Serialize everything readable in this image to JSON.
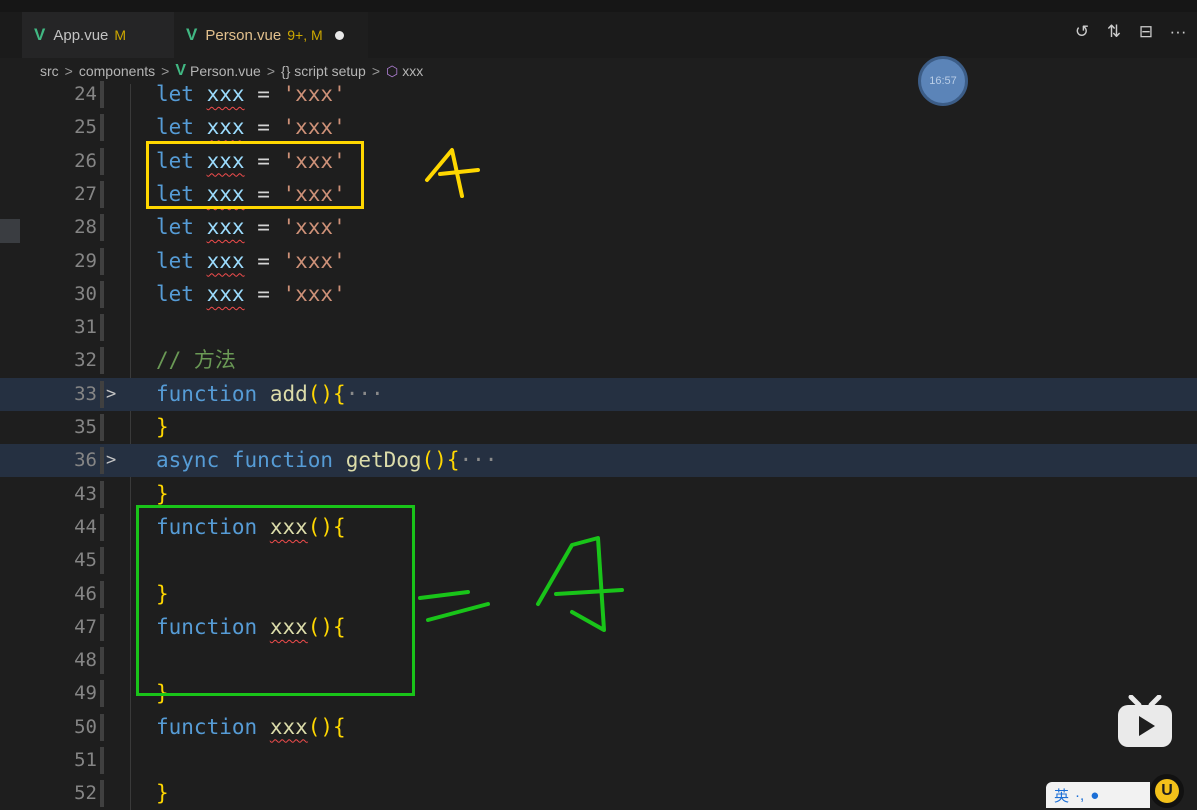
{
  "tabs": [
    {
      "name": "App.vue",
      "status": "M"
    },
    {
      "name": "Person.vue",
      "status": "9+, M"
    }
  ],
  "toolbar_icons": [
    "history-icon",
    "compare-changes-icon",
    "split-editor-icon",
    "more-actions-icon"
  ],
  "toolbar_glyphs": {
    "history": "↺",
    "compare": "⇅",
    "split": "⊟",
    "more": "···"
  },
  "breadcrumb": {
    "items": [
      "src",
      "components",
      "Person.vue",
      "{} script setup",
      "xxx"
    ],
    "separator": ">"
  },
  "code_lines": [
    {
      "num": "24",
      "text": "let xxx = 'xxx'"
    },
    {
      "num": "25",
      "text": "let xxx = 'xxx'"
    },
    {
      "num": "26",
      "text": "let xxx = 'xxx'"
    },
    {
      "num": "27",
      "text": "let xxx = 'xxx'"
    },
    {
      "num": "28",
      "text": "let xxx = 'xxx'"
    },
    {
      "num": "29",
      "text": "let xxx = 'xxx'"
    },
    {
      "num": "30",
      "text": "let xxx = 'xxx'"
    },
    {
      "num": "31",
      "text": ""
    },
    {
      "num": "32",
      "text": "// 方法"
    },
    {
      "num": "33",
      "text": "function add(){···"
    },
    {
      "num": "35",
      "text": "}"
    },
    {
      "num": "36",
      "text": "async function getDog(){···"
    },
    {
      "num": "43",
      "text": "}"
    },
    {
      "num": "44",
      "text": "function xxx(){"
    },
    {
      "num": "45",
      "text": ""
    },
    {
      "num": "46",
      "text": "}"
    },
    {
      "num": "47",
      "text": "function xxx(){"
    },
    {
      "num": "48",
      "text": ""
    },
    {
      "num": "49",
      "text": "}"
    },
    {
      "num": "50",
      "text": "function xxx(){"
    },
    {
      "num": "51",
      "text": ""
    },
    {
      "num": "52",
      "text": "}"
    }
  ],
  "tokens": {
    "let": "let",
    "xxx": "xxx",
    "eq": "=",
    "str_xxx": "'xxx'",
    "comment": "// 方法",
    "function": "function",
    "async": "async",
    "add": "add",
    "getDog": "getDog",
    "parens": "()",
    "lbrace": "{",
    "rbrace": "}",
    "ellipsis": "···"
  },
  "fold_chevron": ">",
  "overlay": {
    "clock_time": "16:57",
    "ime_label": "英",
    "ime_mark": "·,",
    "ime_badge": "U"
  },
  "colors": {
    "annotation_yellow": "#ffd700",
    "annotation_green": "#19c419",
    "vue_green": "#41b883",
    "modified_tab": "#e2c08d"
  }
}
